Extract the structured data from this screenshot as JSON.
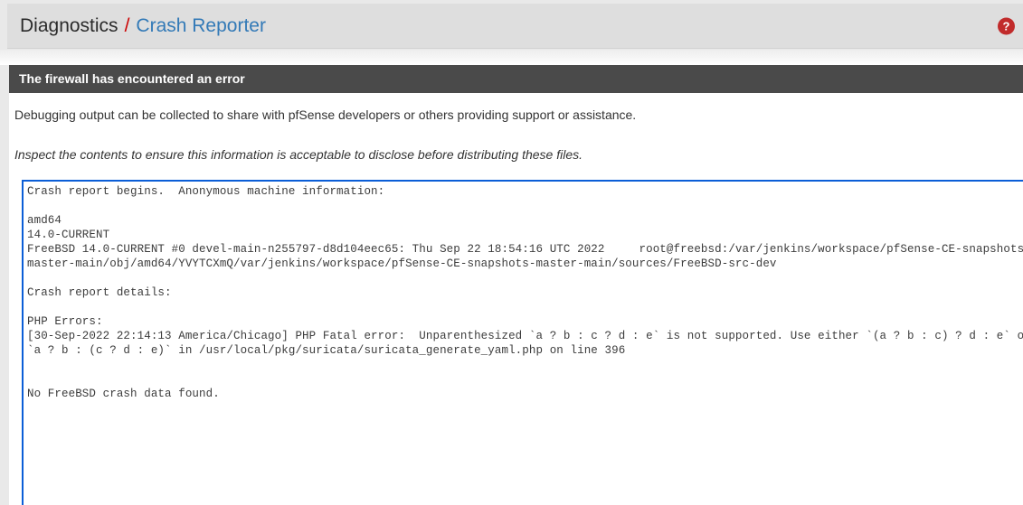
{
  "breadcrumb": {
    "root": "Diagnostics",
    "separator": "/",
    "current": "Crash Reporter",
    "help_icon": "help-question-icon",
    "help_label": "?"
  },
  "panel": {
    "heading": "The firewall has encountered an error",
    "description": "Debugging output can be collected to share with pfSense developers or others providing support or assistance.",
    "notice": "Inspect the contents to ensure this information is acceptable to disclose before distributing these files."
  },
  "crash_output": {
    "text": "Crash report begins.  Anonymous machine information:\n\namd64\n14.0-CURRENT\nFreeBSD 14.0-CURRENT #0 devel-main-n255797-d8d104eec65: Thu Sep 22 18:54:16 UTC 2022     root@freebsd:/var/jenkins/workspace/pfSense-CE-snapshots-master-main/obj/amd64/YVYTCXmQ/var/jenkins/workspace/pfSense-CE-snapshots-master-main/sources/FreeBSD-src-dev\n\nCrash report details:\n\nPHP Errors:\n[30-Sep-2022 22:14:13 America/Chicago] PHP Fatal error:  Unparenthesized `a ? b : c ? d : e` is not supported. Use either `(a ? b : c) ? d : e` or `a ? b : (c ? d : e)` in /usr/local/pkg/suricata/suricata_generate_yaml.php on line 396\n\n\nNo FreeBSD crash data found.\n"
  },
  "colors": {
    "breadcrumb_link": "#337ab7",
    "breadcrumb_separator": "#cc0000",
    "panel_heading_bg": "#4a4a4a",
    "help_icon_bg": "#c12b2b",
    "textarea_focus_border": "#0b5ed7"
  }
}
